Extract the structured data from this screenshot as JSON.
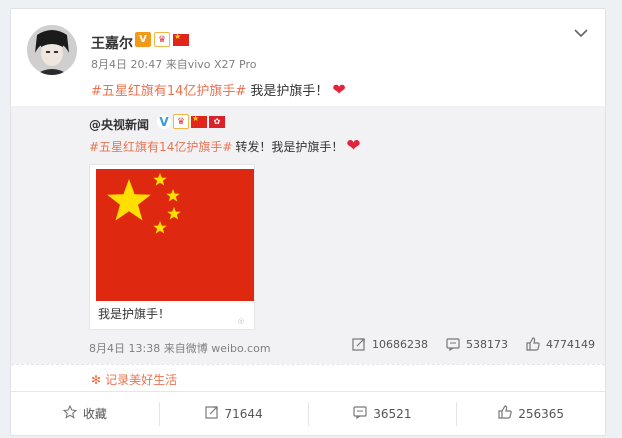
{
  "user": {
    "name": "王嘉尔"
  },
  "post": {
    "time": "8月4日 20:47",
    "source": "来自vivo X27 Pro",
    "hashtag": "#五星红旗有14亿护旗手#",
    "text": "我是护旗手！"
  },
  "repost": {
    "author": "@央视新闻",
    "hashtag": "#五星红旗有14亿护旗手#",
    "text": "转发！我是护旗手！",
    "media_caption": "我是护旗手！",
    "time": "8月4日 13:38",
    "source": "来自微博 weibo.com",
    "stats": {
      "reposts": "10686238",
      "comments": "538173",
      "likes": "4774149"
    }
  },
  "topic": {
    "label": "记录美好生活"
  },
  "footer": {
    "favorite_label": "收藏",
    "repost_count": "71644",
    "comment_count": "36521",
    "like_count": "256365"
  },
  "colors": {
    "accent": "#eb7350",
    "flag_red": "#de2910",
    "flag_star": "#ffde00",
    "heart": "#e0253a",
    "card_bg": "#ffffff",
    "repost_bg": "#f2f2f5"
  },
  "icons": [
    "chevron-down-icon",
    "heart-icon",
    "repost-icon",
    "comment-icon",
    "like-icon",
    "star-icon",
    "topic-icon"
  ]
}
